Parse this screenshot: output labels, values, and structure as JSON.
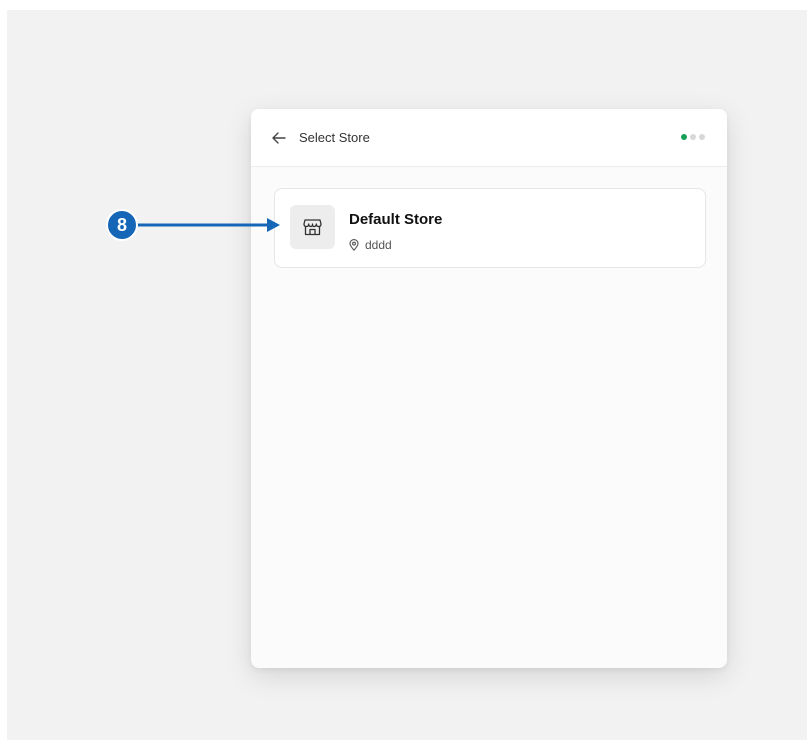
{
  "header": {
    "title": "Select Store",
    "back_icon": "arrow-left-icon",
    "step_indicator": {
      "total": 3,
      "active": 1,
      "active_color": "#18a058",
      "inactive_color": "#d8d8d8"
    }
  },
  "stores": [
    {
      "name": "Default Store",
      "location": "dddd",
      "icon": "store-icon",
      "location_icon": "map-pin-icon"
    }
  ],
  "annotation": {
    "number": "8",
    "color": "#1666b8"
  }
}
